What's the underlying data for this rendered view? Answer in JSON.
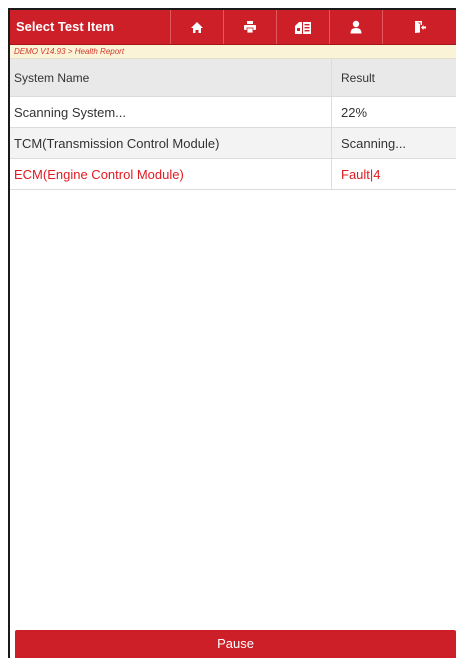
{
  "toolbar": {
    "title": "Select Test Item",
    "buttons": [
      {
        "name": "home-icon"
      },
      {
        "name": "print-icon"
      },
      {
        "name": "report-icon"
      },
      {
        "name": "user-icon"
      },
      {
        "name": "exit-icon"
      }
    ]
  },
  "breadcrumb": "DEMO V14.93 > Health Report",
  "table": {
    "headers": [
      "System Name",
      "Result"
    ],
    "rows": [
      {
        "system": "Scanning System...",
        "result": "22%"
      },
      {
        "system": "TCM(Transmission Control Module)",
        "result": "Scanning..."
      },
      {
        "system": "ECM(Engine Control Module)",
        "result": "Fault|4",
        "status": "fault"
      }
    ]
  },
  "pause_label": "Pause",
  "colors": {
    "brand_red": "#cc1f27",
    "fault_text": "#e11b22",
    "breadcrumb_bg": "#fbf3d8",
    "header_row_bg": "#e9e9e9"
  }
}
